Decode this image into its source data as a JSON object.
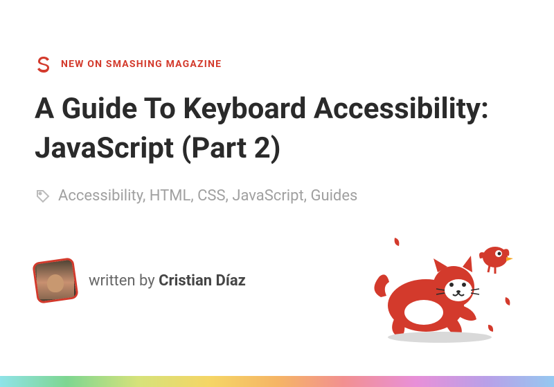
{
  "brand": {
    "logo_label": "smashing-s",
    "accent_color": "#d33a2c"
  },
  "eyebrow": "NEW ON SMASHING MAGAZINE",
  "title": "A Guide To Keyboard Accessibility: JavaScript (Part 2)",
  "tags": "Accessibility, HTML, CSS, JavaScript, Guides",
  "author": {
    "prefix": "written by ",
    "name": "Cristian Díaz"
  },
  "mascot": {
    "label": "smashing-cat-chasing-bird"
  }
}
